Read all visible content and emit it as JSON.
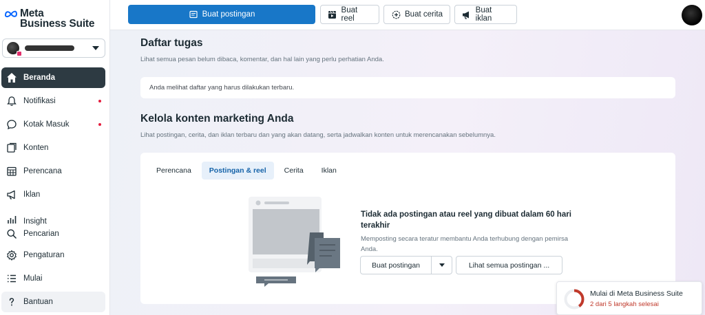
{
  "brand": {
    "line1": "Meta",
    "line2": "Business Suite",
    "color": "#0866ff"
  },
  "account": {
    "name": ""
  },
  "sidebar": {
    "items": [
      {
        "label": "Beranda",
        "icon": "home-icon",
        "active": true
      },
      {
        "label": "Notifikasi",
        "icon": "bell-icon",
        "badge": true
      },
      {
        "label": "Kotak Masuk",
        "icon": "chat-bubble-icon",
        "badge": true
      },
      {
        "label": "Konten",
        "icon": "content-icon"
      },
      {
        "label": "Perencana",
        "icon": "calendar-icon"
      },
      {
        "label": "Iklan",
        "icon": "megaphone-icon"
      },
      {
        "label": "Insight",
        "icon": "bar-chart-icon"
      },
      {
        "label": "Pencarian",
        "icon": "search-icon"
      },
      {
        "label": "Pengaturan",
        "icon": "gear-icon"
      },
      {
        "label": "Mulai",
        "icon": "list-icon"
      },
      {
        "label": "Bantuan",
        "icon": "question-icon"
      }
    ]
  },
  "topbar": {
    "create_post": "Buat postingan",
    "create_reel": "Buat reel",
    "create_story": "Buat cerita",
    "create_ad": "Buat iklan"
  },
  "todo": {
    "title": "Daftar tugas",
    "subtitle": "Lihat semua pesan belum dibaca, komentar, dan hal lain yang perlu perhatian Anda.",
    "message": "Anda melihat daftar yang harus dilakukan terbaru."
  },
  "marketing": {
    "title": "Kelola konten marketing Anda",
    "subtitle": "Lihat postingan, cerita, dan iklan terbaru dan yang akan datang, serta jadwalkan konten untuk merencanakan sebelumnya.",
    "tabs": [
      "Perencana",
      "Postingan & reel",
      "Cerita",
      "Iklan"
    ],
    "active_tab": 1,
    "empty_title": "Tidak ada postingan atau reel yang dibuat dalam 60 hari terakhir",
    "empty_subtitle": "Memposting secara teratur membantu Anda terhubung dengan pemirsa Anda.",
    "create_button": "Buat postingan",
    "see_all_button": "Lihat semua postingan ..."
  },
  "onboarding": {
    "title": "Mulai di Meta Business Suite",
    "progress_text": "2 dari 5 langkah selesai",
    "completed_steps": 2,
    "total_steps": 5,
    "ring_color": "#c0392b"
  },
  "colors": {
    "primary": "#1877c8",
    "sidebar_active": "#2d3a42",
    "badge": "#e41e3f"
  }
}
